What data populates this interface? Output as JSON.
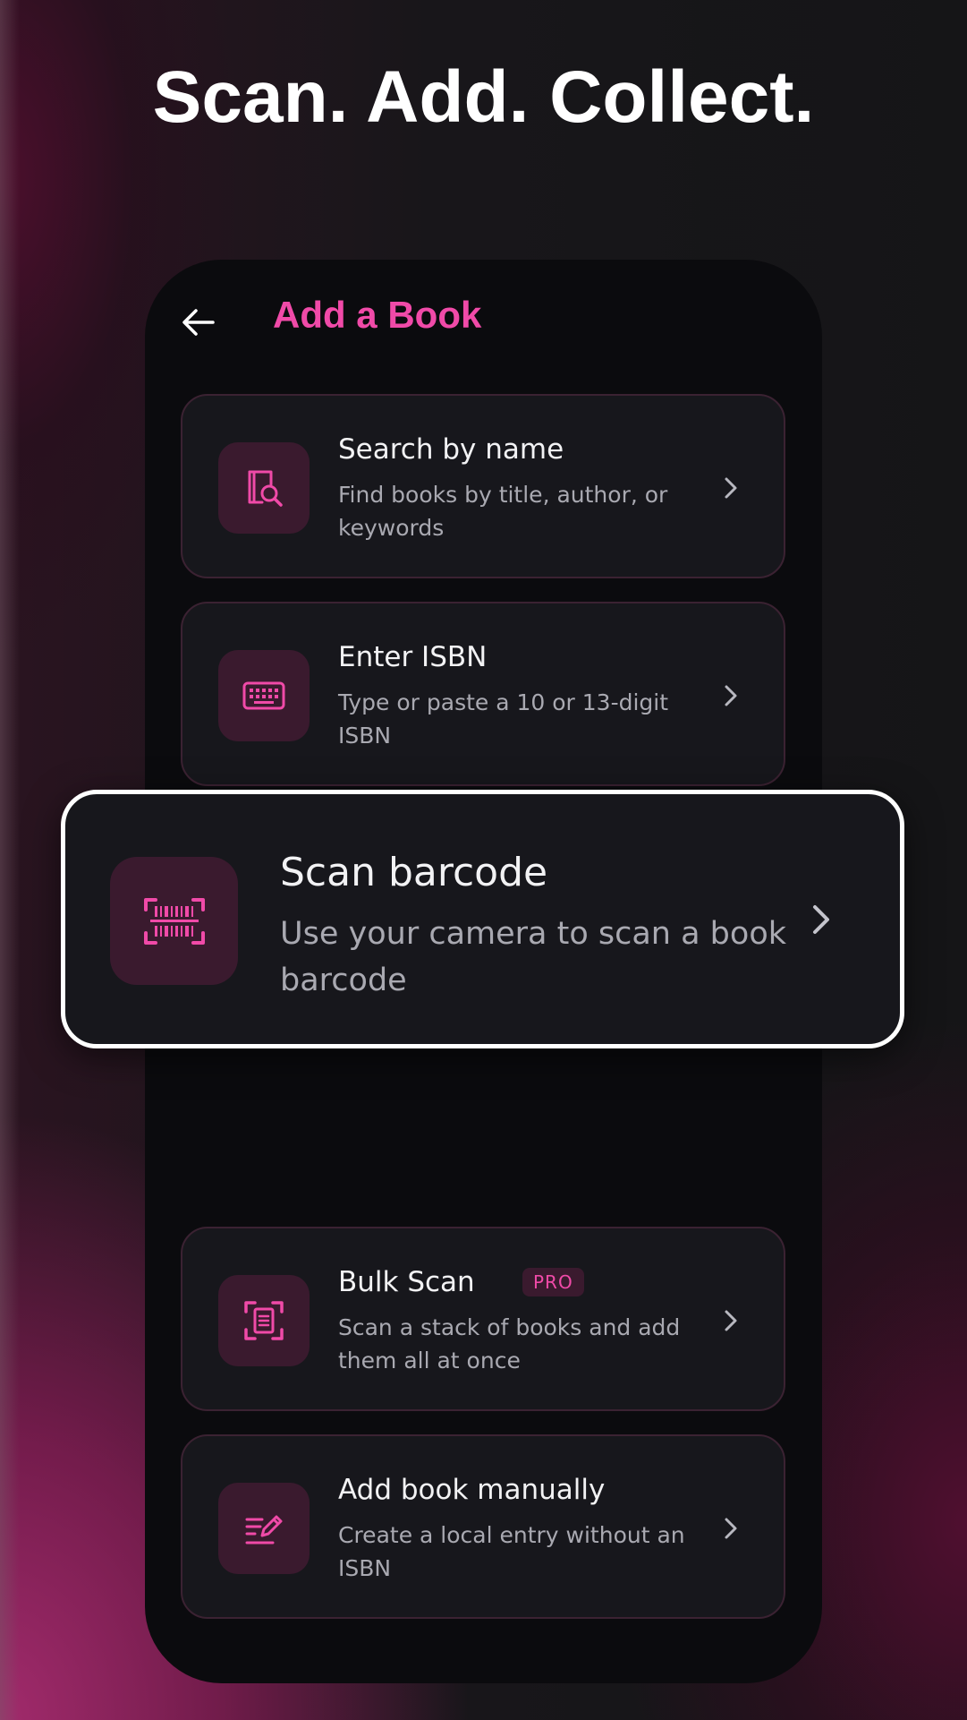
{
  "headline": "Scan. Add. Collect.",
  "app_bar": {
    "title": "Add a Book",
    "back_icon": "arrow-left-icon"
  },
  "options": [
    {
      "title": "Search by name",
      "description": "Find books by title, author, or keywords",
      "icon": "book-search-icon"
    },
    {
      "title": "Enter ISBN",
      "description": "Type or paste a 10 or 13-digit ISBN",
      "icon": "keyboard-icon"
    },
    {
      "title": "Scan barcode",
      "description": "Use your camera to scan a book barcode",
      "icon": "barcode-scan-icon"
    },
    {
      "title": "Bulk Scan",
      "badge": "PRO",
      "description": "Scan a stack of books and add them all at once",
      "icon": "document-scan-icon"
    },
    {
      "title": "Add book manually",
      "description": "Create a local entry without an ISBN",
      "icon": "edit-note-icon"
    }
  ],
  "colors": {
    "accent": "#f04aa8",
    "card_bg": "#17171c",
    "icon_tile_bg": "#3a1a2e",
    "screen_bg": "#0b0b0e"
  }
}
